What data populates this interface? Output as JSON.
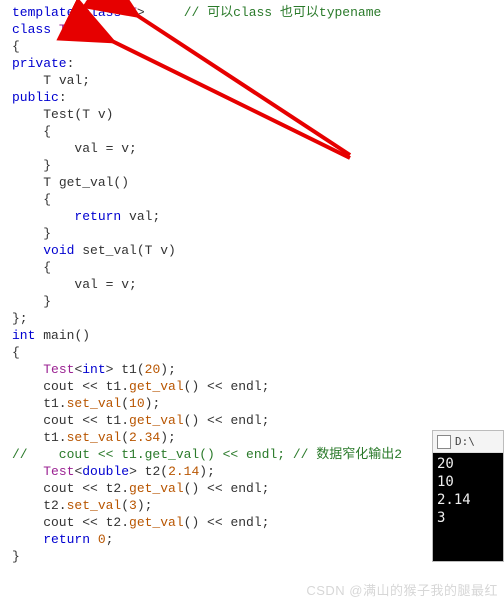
{
  "comment_top": "// 可以class 也可以typename",
  "code": {
    "template_kw": "template",
    "class_kw": "class",
    "T": "T",
    "className": "Test",
    "private": "private",
    "public": "public",
    "valDecl": "T val;",
    "ctorSig": "Test(T v)",
    "ctorBody": "val = v;",
    "getSig": "T get_val()",
    "getBody": "return val;",
    "setSig": "void set_val(T v)",
    "setBody": "val = v;",
    "intKw": "int",
    "mainName": "main",
    "declT1": "Test<int> t1(20);",
    "coutT1a": "cout << t1.get_val() << endl;",
    "set10": "t1.set_val(10);",
    "coutT1b": "cout << t1.get_val() << endl;",
    "set234": "t1.set_val(2.34);",
    "commentedLine": "//    cout << t1.get_val() << endl; // 数据窄化输出2",
    "declT2": "Test<double> t2(2.14);",
    "coutT2a": "cout << t2.get_val() << endl;",
    "set3": "t2.set_val(3);",
    "coutT2b": "cout << t2.get_val() << endl;",
    "ret": "return 0;"
  },
  "console": {
    "title": "D:\\",
    "lines": [
      "20",
      "10",
      "2.14",
      "3"
    ]
  },
  "watermark": "CSDN @满山的猴子我的腿最红"
}
